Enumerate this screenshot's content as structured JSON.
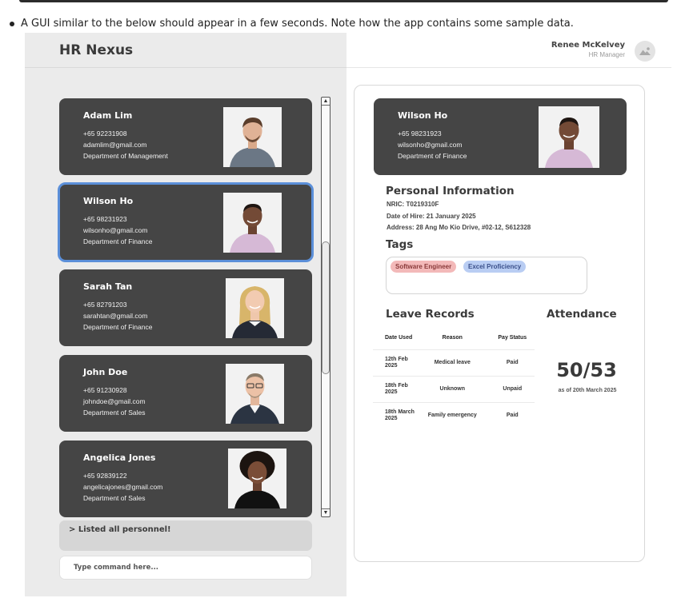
{
  "page": {
    "bullet_text": "A GUI similar to the below should appear in a few seconds. Note how the app contains some sample data."
  },
  "app": {
    "title": "HR Nexus",
    "user": {
      "name": "Renee McKelvey",
      "role": "HR Manager"
    }
  },
  "personnel": [
    {
      "name": "Adam Lim",
      "phone": "+65 92231908",
      "email": "adamlim@gmail.com",
      "department": "Department of Management",
      "selected": false
    },
    {
      "name": "Wilson Ho",
      "phone": "+65 98231923",
      "email": "wilsonho@gmail.com",
      "department": "Department of Finance",
      "selected": true
    },
    {
      "name": "Sarah Tan",
      "phone": "+65 82791203",
      "email": "sarahtan@gmail.com",
      "department": "Department of Finance",
      "selected": false
    },
    {
      "name": "John Doe",
      "phone": "+65 91230928",
      "email": "johndoe@gmail.com",
      "department": "Department of Sales",
      "selected": false
    },
    {
      "name": "Angelica Jones",
      "phone": "+65 92839122",
      "email": "angelicajones@gmail.com",
      "department": "Department of Sales",
      "selected": false
    }
  ],
  "result_box": {
    "text": "> Listed all personnel!"
  },
  "command": {
    "placeholder": "Type command here..."
  },
  "detail": {
    "card": {
      "name": "Wilson Ho",
      "phone": "+65 98231923",
      "email": "wilsonho@gmail.com",
      "department": "Department of Finance"
    },
    "personal_info": {
      "title": "Personal Information",
      "nric": "NRIC: T0219310F",
      "hire": "Date of Hire: 21 January 2025",
      "address": "Address: 28 Ang Mo Kio Drive, #02-12, S612328"
    },
    "tags": {
      "title": "Tags",
      "items": [
        "Software Engineer",
        "Excel Proficiency"
      ],
      "colors": {
        "pink": "#f3b9b9",
        "blue": "#b9cdf3"
      }
    },
    "leave": {
      "title": "Leave Records",
      "headers": [
        "Date Used",
        "Reason",
        "Pay Status"
      ],
      "rows": [
        [
          "12th Feb 2025",
          "Medical leave",
          "Paid"
        ],
        [
          "18th Feb 2025",
          "Unknown",
          "Unpaid"
        ],
        [
          "18th March 2025",
          "Family emergency",
          "Paid"
        ]
      ]
    },
    "attendance": {
      "title": "Attendance",
      "value": "50/53",
      "as_of": "as of 20th March 2025"
    }
  },
  "colors": {
    "card_bg": "#454545",
    "left_bg": "#ebebeb",
    "selection": "#5b8fd9"
  }
}
